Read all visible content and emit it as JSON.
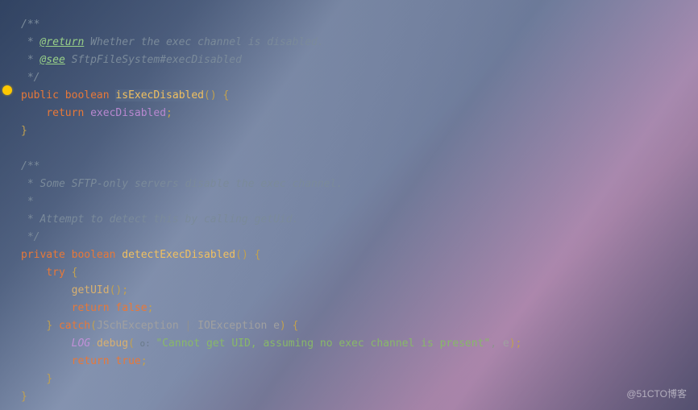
{
  "code": {
    "line1": "/**",
    "line2_prefix": " * ",
    "line2_tag": "@return",
    "line2_text": " Whether the exec channel is disabled.",
    "line3_prefix": " * ",
    "line3_tag": "@see",
    "line3_text1": " SftpFileSystem",
    "line3_text2": "#execDisabled",
    "line4": " */",
    "line5_kw1": "public",
    "line5_kw2": "boolean",
    "line5_method": "isExecDisabled",
    "line5_paren": "()",
    "line5_brace": " {",
    "line6_kw": "return",
    "line6_field": "execDisabled",
    "line6_semi": ";",
    "line7_brace": "}",
    "line8": "",
    "line9": "/**",
    "line10": " * Some SFTP-only servers disable the exec channel.",
    "line11": " *",
    "line12": " * Attempt to detect this by calling getUid.",
    "line13": " */",
    "line14_kw1": "private",
    "line14_kw2": "boolean",
    "line14_method": "detectExecDisabled",
    "line14_paren": "()",
    "line14_brace": " {",
    "line15_kw": "try",
    "line15_brace": " {",
    "line16_method": "getUId",
    "line16_paren": "()",
    "line16_semi": ";",
    "line17_kw": "return",
    "line17_val": "false",
    "line17_semi": ";",
    "line18_brace1": "}",
    "line18_kw": " catch",
    "line18_paren1": "(",
    "line18_type1": "JSchException",
    "line18_pipe": " | ",
    "line18_type2": "IOException",
    "line18_param": " e",
    "line18_paren2": ")",
    "line18_brace2": " {",
    "line19_const": "LOG",
    "line19_dot": ".",
    "line19_method": "debug",
    "line19_paren1": "(",
    "line19_hint": " o: ",
    "line19_string": "\"Cannot get UID, assuming no exec channel is present\"",
    "line19_comma": ",",
    "line19_param": " e",
    "line19_paren2": ")",
    "line19_semi": ";",
    "line20_kw": "return",
    "line20_val": "true",
    "line20_semi": ";",
    "line21_brace": "}",
    "line22_brace": "}"
  },
  "watermark": "@51CTO博客"
}
